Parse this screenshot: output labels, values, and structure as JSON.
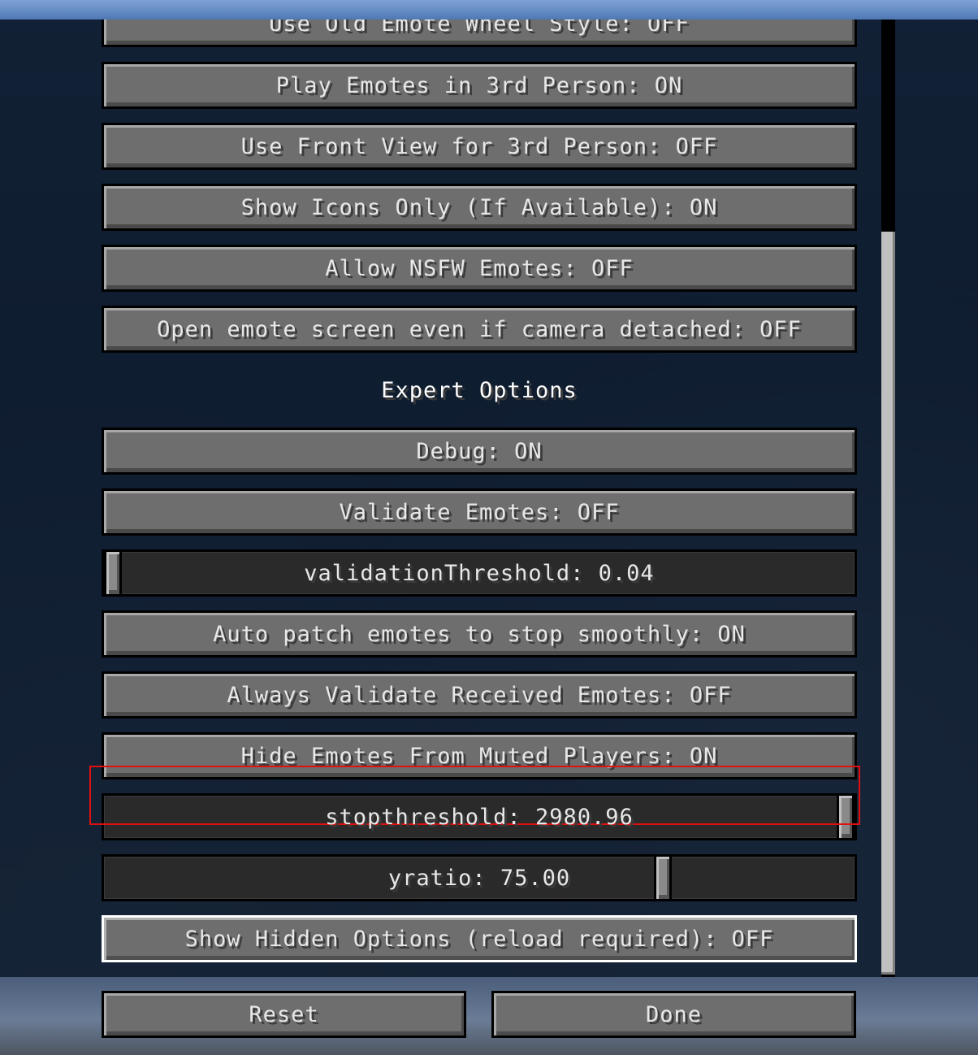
{
  "settings": {
    "partial_top": "Use Old Emote Wheel Style: OFF",
    "play_3rd_person": "Play Emotes in 3rd Person: ON",
    "front_view": "Use Front View for 3rd Person: OFF",
    "icons_only": "Show Icons Only (If Available): ON",
    "allow_nsfw": "Allow NSFW Emotes: OFF",
    "open_detached": "Open emote screen even if camera detached: OFF",
    "expert_title": "Expert Options",
    "debug": "Debug: ON",
    "validate": "Validate Emotes: OFF",
    "validation_threshold": "validationThreshold: 0.04",
    "validation_threshold_level": 0.0,
    "auto_patch": "Auto patch emotes to stop smoothly: ON",
    "always_validate": "Always Validate Received Emotes: OFF",
    "hide_muted": "Hide Emotes From Muted Players: ON",
    "stop_threshold": "stopthreshold: 2980.96",
    "stop_threshold_level": 1.0,
    "yratio": "yratio: 75.00",
    "yratio_level": 0.75,
    "show_hidden": "Show Hidden Options (reload required): OFF"
  },
  "footer": {
    "reset_label": "Reset",
    "done_label": "Done"
  },
  "colors": {
    "highlight": "#e01010",
    "button_face": "#6e6e6e",
    "slider_track": "#2a2a2a"
  }
}
